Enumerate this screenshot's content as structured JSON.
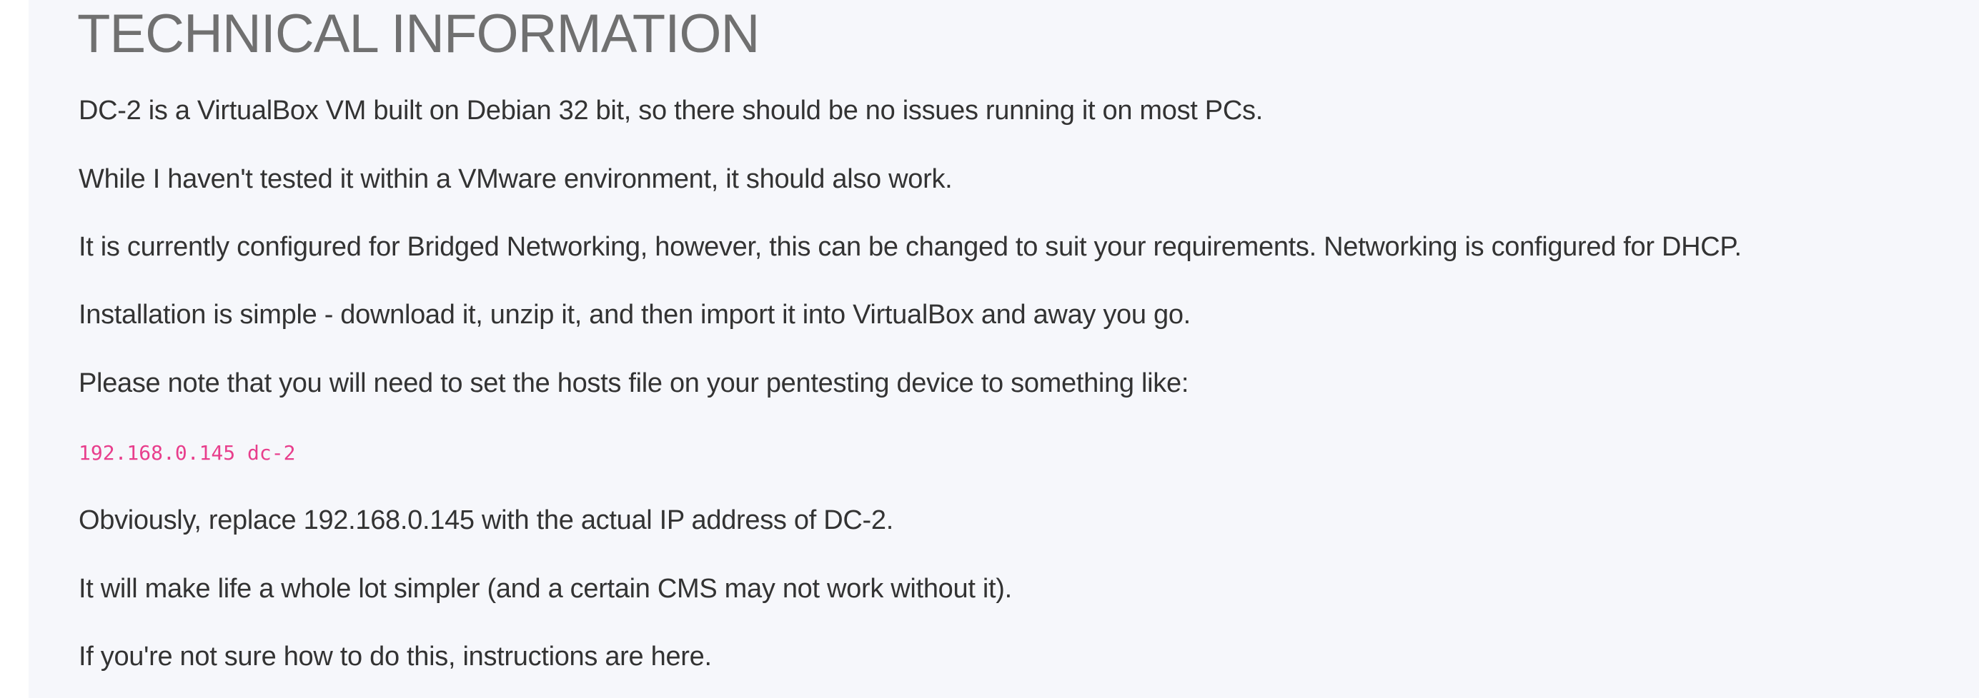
{
  "heading": "TECHNICAL INFORMATION",
  "paragraphs": [
    "DC-2 is a VirtualBox VM built on Debian 32 bit, so there should be no issues running it on most PCs.",
    "While I haven't tested it within a VMware environment, it should also work.",
    "It is currently configured for Bridged Networking, however, this can be changed to suit your requirements. Networking is configured for DHCP.",
    "Installation is simple - download it, unzip it, and then import it into VirtualBox and away you go.",
    "Please note that you will need to set the hosts file on your pentesting device to something like:"
  ],
  "code_line": "192.168.0.145 dc-2",
  "paragraphs_after": [
    "Obviously, replace 192.168.0.145 with the actual IP address of DC-2.",
    "It will make life a whole lot simpler (and a certain CMS may not work without it)."
  ],
  "last": {
    "prefix": "If you're not sure how to do this, instructions are ",
    "link": "here",
    "suffix": "."
  },
  "colors": {
    "code": "#e83e8c",
    "text": "#333333",
    "heading": "#707070",
    "background": "#f6f7fb"
  }
}
